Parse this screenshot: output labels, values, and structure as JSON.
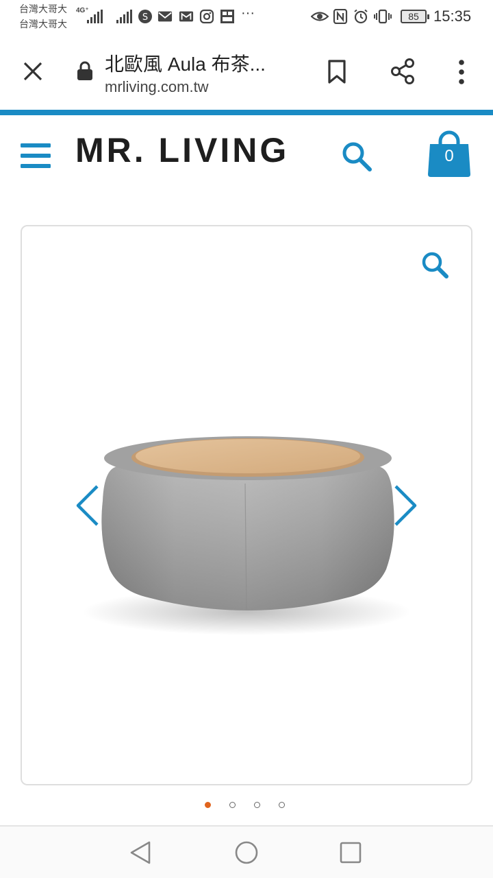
{
  "status_bar": {
    "carrier_1": "台灣大哥大",
    "carrier_2": "台灣大哥大",
    "network": "4G⁺",
    "battery": "85",
    "time": "15:35",
    "more": "···"
  },
  "browser": {
    "page_title": "北歐風 Aula 布茶...",
    "domain": "mrliving.com.tw"
  },
  "site": {
    "logo": "MR. LIVING",
    "cart_count": "0",
    "brand_color": "#1a8bc4"
  },
  "gallery": {
    "slide_count": 4,
    "active_slide": 1
  },
  "android_nav": {
    "icons": [
      "back-icon",
      "home-icon",
      "recents-icon"
    ]
  }
}
